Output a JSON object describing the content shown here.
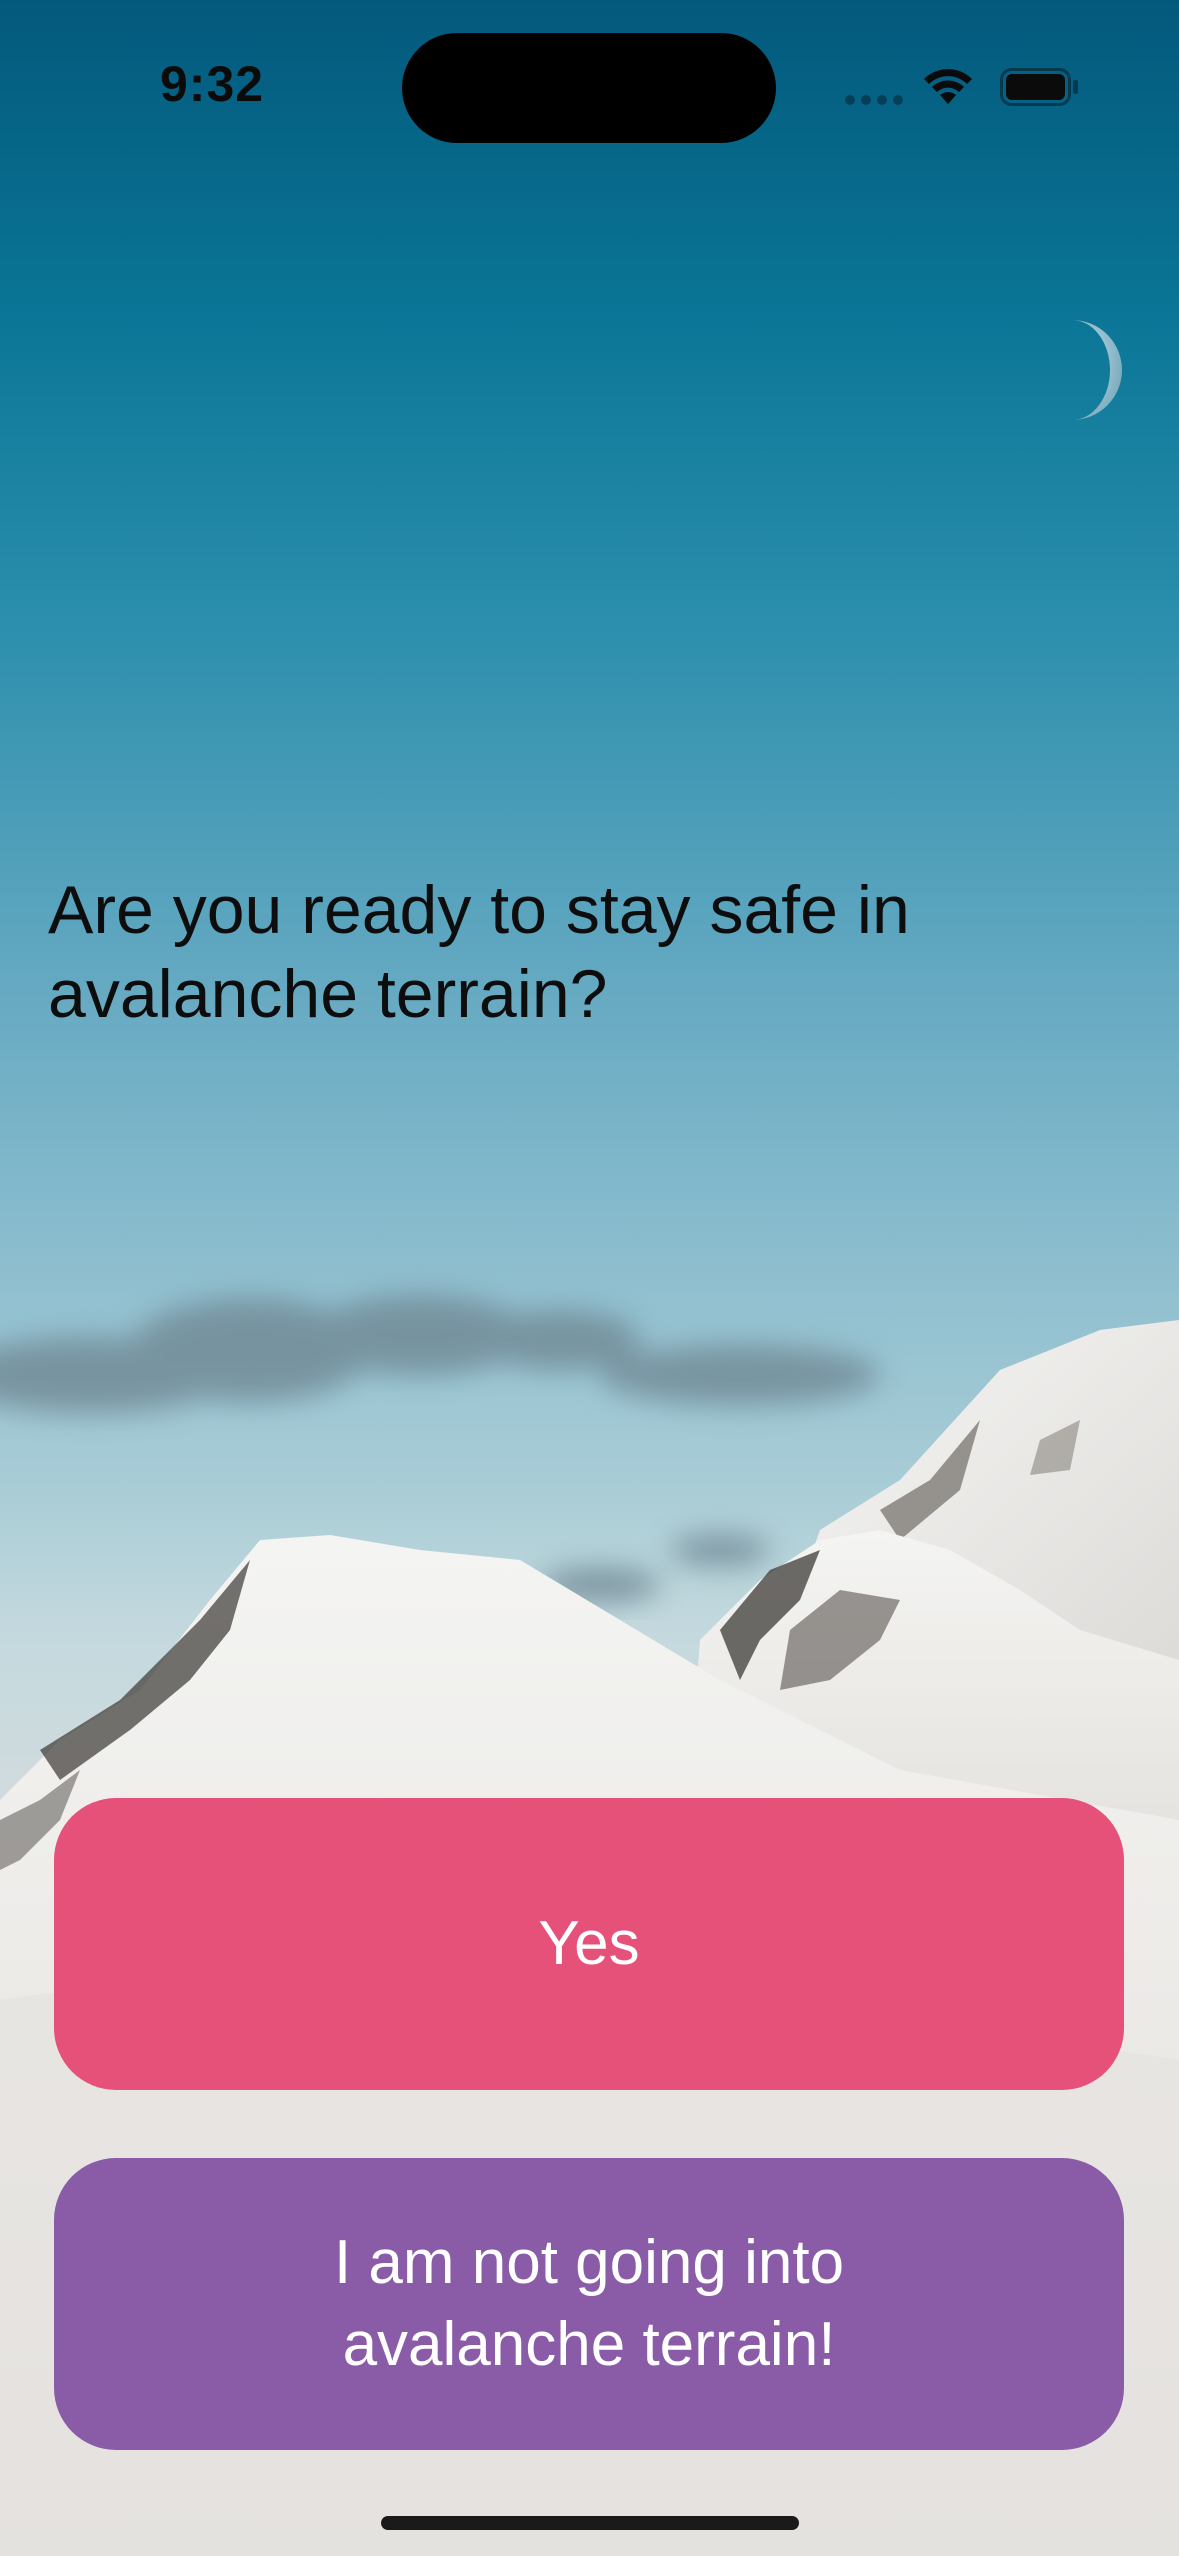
{
  "status_bar": {
    "time": "9:32",
    "icons": [
      "cellular-signal-icon",
      "wifi-icon",
      "battery-icon"
    ]
  },
  "prompt": {
    "question": "Are you ready to stay safe in avalanche terrain?"
  },
  "buttons": {
    "yes_label": "Yes",
    "no_label": "I am not going into\navalanche terrain!"
  },
  "colors": {
    "yes_button": "#e6517a",
    "no_button": "#8a5ca8",
    "sky_top": "#03597c",
    "snow": "#e3e1de"
  },
  "background": {
    "scene": "mountain-landscape",
    "elements": [
      "moon",
      "clouds",
      "snowy-peaks"
    ]
  }
}
